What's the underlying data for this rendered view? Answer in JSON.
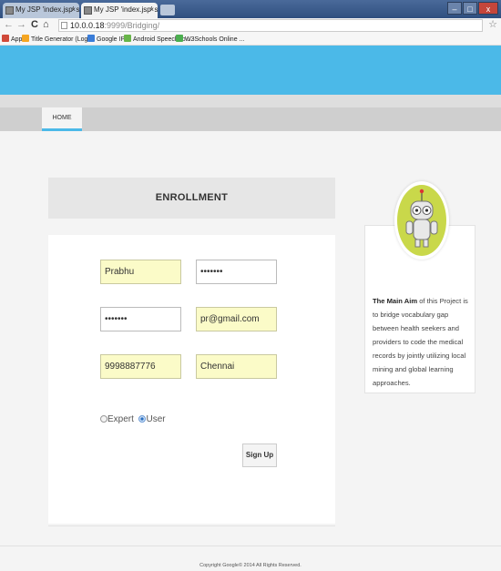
{
  "browser": {
    "tabs": [
      {
        "title": "My JSP 'index.jsp' starting",
        "close": "×"
      },
      {
        "title": "My JSP 'index.jsp' starting",
        "close": "×"
      }
    ],
    "window_buttons": {
      "minimize": "–",
      "maximize": "□",
      "close": "x"
    },
    "url_host": "10.0.0.18",
    "url_path": ":9999/Bridging/",
    "bookmarks": [
      {
        "label": "Apps",
        "color": "#d04a3a"
      },
      {
        "label": "Title Generator (Log...",
        "color": "#f5a623"
      },
      {
        "label": "Google IP",
        "color": "#3b7dd8"
      },
      {
        "label": "Android Speech to ...",
        "color": "#69b54a"
      },
      {
        "label": "W3Schools Online ...",
        "color": "#4caf50"
      }
    ]
  },
  "site": {
    "accent_color": "#4bb9e8",
    "nav": {
      "home": "HOME"
    },
    "enrollment": {
      "title": "ENROLLMENT",
      "first_name": "Prabhu",
      "password": "•••••••",
      "confirm_password": "•••••••",
      "email": "pr@gmail.com",
      "phone": "9998887776",
      "city": "Chennai",
      "role_expert": "Expert",
      "role_user": "User",
      "selected_role": "User",
      "signup": "Sign Up"
    },
    "info": {
      "lead": "The Main Aim",
      "text": " of this Project is to bridge vocabulary gap between health seekers and providers to code the medical records by jointly utilizing local mining and global learning approaches."
    },
    "footer": "Copyright Google© 2014 All Rights Reserved."
  }
}
